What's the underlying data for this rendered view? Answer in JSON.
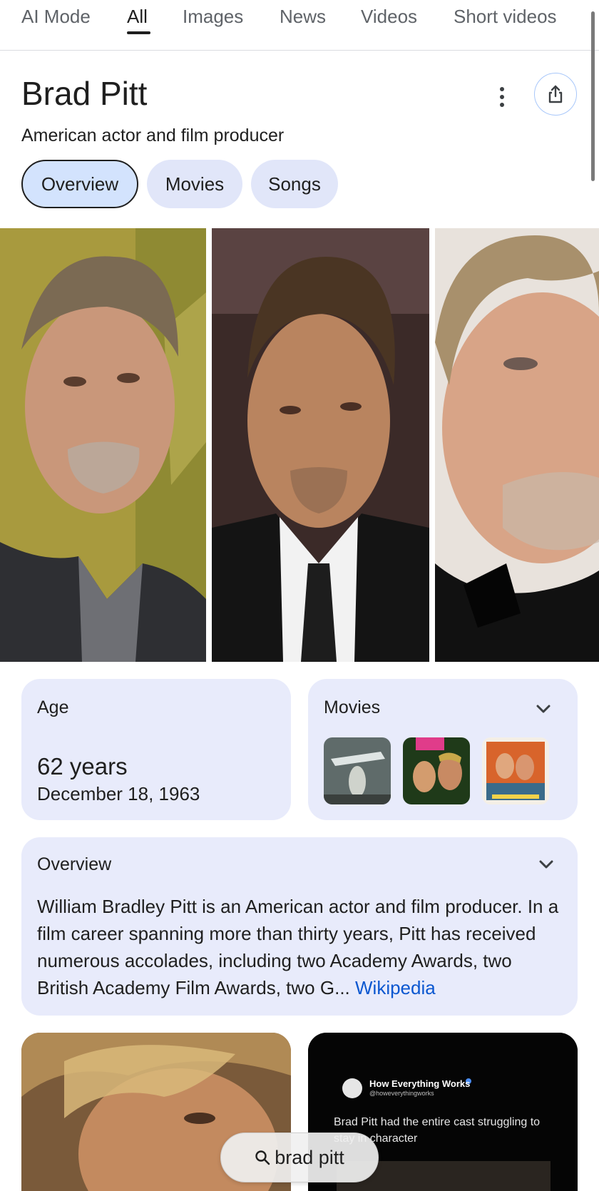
{
  "tabs": [
    {
      "label": "AI Mode"
    },
    {
      "label": "All"
    },
    {
      "label": "Images"
    },
    {
      "label": "News"
    },
    {
      "label": "Videos"
    },
    {
      "label": "Short videos"
    }
  ],
  "entity": {
    "title": "Brad Pitt",
    "subtitle": "American actor and film producer"
  },
  "chips": [
    {
      "label": "Overview",
      "selected": true
    },
    {
      "label": "Movies",
      "selected": false
    },
    {
      "label": "Songs",
      "selected": false
    }
  ],
  "age_card": {
    "label": "Age",
    "value": "62 years",
    "date": "December 18, 1963"
  },
  "movies_card": {
    "label": "Movies"
  },
  "overview_card": {
    "label": "Overview",
    "text": "William Bradley Pitt is an American actor and film producer. In a film career spanning more than thirty years, Pitt has received numerous accolades, including two Academy Awards, two British Academy Film Awards, two G...",
    "source": "Wikipedia"
  },
  "tweet_card": {
    "name": "How Everything Works",
    "handle": "@howeverythingworks",
    "text": "Brad Pitt had the entire cast struggling to stay in character"
  },
  "search_pill": {
    "query": "brad pitt"
  },
  "colors": {
    "accent": "#0b57d0",
    "chip_bg": "#e1e6f9",
    "chip_selected_bg": "#d3e3fd",
    "card_bg": "#e8ebfb"
  }
}
